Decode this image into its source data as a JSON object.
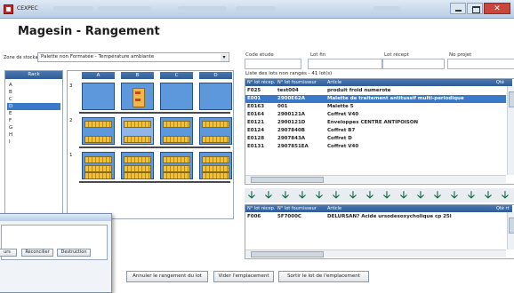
{
  "window": {
    "app_name": "CEXPEC",
    "close_glyph": "✕"
  },
  "page": {
    "title": "Magesin - Rangement"
  },
  "zone": {
    "label": "Zone de stockage :",
    "value": "Palette non Formatée - Température ambiante"
  },
  "rack": {
    "header": "Rack",
    "items": [
      "A",
      "B",
      "C",
      "D",
      "E",
      "F",
      "G",
      "H",
      "I"
    ],
    "selected_index": 3
  },
  "grid": {
    "columns": [
      "A",
      "B",
      "C",
      "D"
    ],
    "rows": [
      "3",
      "2",
      "1"
    ],
    "selected_row": 1,
    "selected_col": 1
  },
  "fields": {
    "code_etude": "Code étude",
    "lot_fin": "Lot fin",
    "lot_recept": "Lot récept",
    "no_projet": "No projet"
  },
  "list_label": "Liste des lots non rangés - 41 lot(s)",
  "lots_table": {
    "headers": [
      "N° lot récep.",
      "N° lot fournisseur",
      "Article",
      "Qté"
    ],
    "rows": [
      [
        "F025",
        "test004",
        "produit froid numerote"
      ],
      [
        "E001",
        "2900E62A",
        "Malette de traitement antitussif multi-periodique"
      ],
      [
        "E0163",
        "001",
        "Malette 5"
      ],
      [
        "E0164",
        "2900121A",
        "Coffret V40"
      ],
      [
        "E0121",
        "2900121D",
        "Enveloppes CENTRE ANTIPOISON"
      ],
      [
        "E0124",
        "2907840B",
        "Coffret B7"
      ],
      [
        "E0128",
        "2907843A",
        "Coffret D"
      ],
      [
        "E0131",
        "2907851EA",
        "Coffret V40"
      ]
    ],
    "selected_index": 1
  },
  "placed_table": {
    "headers": [
      "N° lot récep.",
      "N° lot fournisseur",
      "Article",
      "Qté rt"
    ],
    "rows": [
      [
        "F006",
        "5F7000C",
        "DELURSAN? Acide ursodesoxycholique cp 25l"
      ]
    ]
  },
  "arrow_glyph": "🡣",
  "buttons": {
    "cancel": "Annuler le rangement du lot",
    "empty": "Vider l'emplacement",
    "remove": "Sortir le lot de l'emplacement"
  },
  "win2": {
    "btn_partial": "urs",
    "btn_reconcile": "Réconcilier",
    "btn_destruction": "Destruction"
  }
}
